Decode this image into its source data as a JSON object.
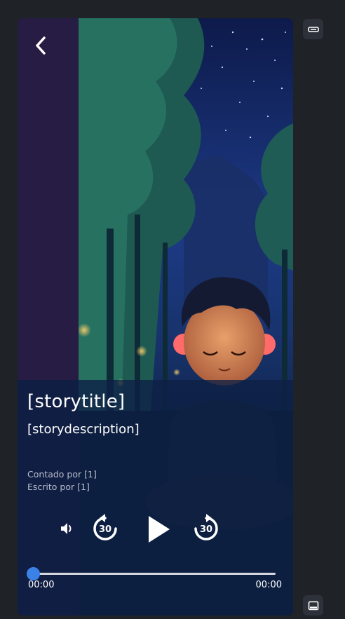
{
  "story": {
    "title": "[storytitle]",
    "description": "[storydescription]",
    "narrated_by": "Contado por [1]",
    "written_by": "Escrito por [1]"
  },
  "player": {
    "elapsed": "00:00",
    "total": "00:00",
    "progress": 0,
    "skip_seconds": "30"
  },
  "colors": {
    "page_background": "#1f2227",
    "panel_overlay": "#0e2046",
    "accent": "#3b82e6",
    "left_strip": "#261c44"
  },
  "icons": {
    "back": "chevron-left-icon",
    "volume": "volume-icon",
    "rewind": "rewind-30-icon",
    "play": "play-icon",
    "forward": "forward-30-icon",
    "collapse": "minimize-icon",
    "panel": "panel-icon"
  }
}
